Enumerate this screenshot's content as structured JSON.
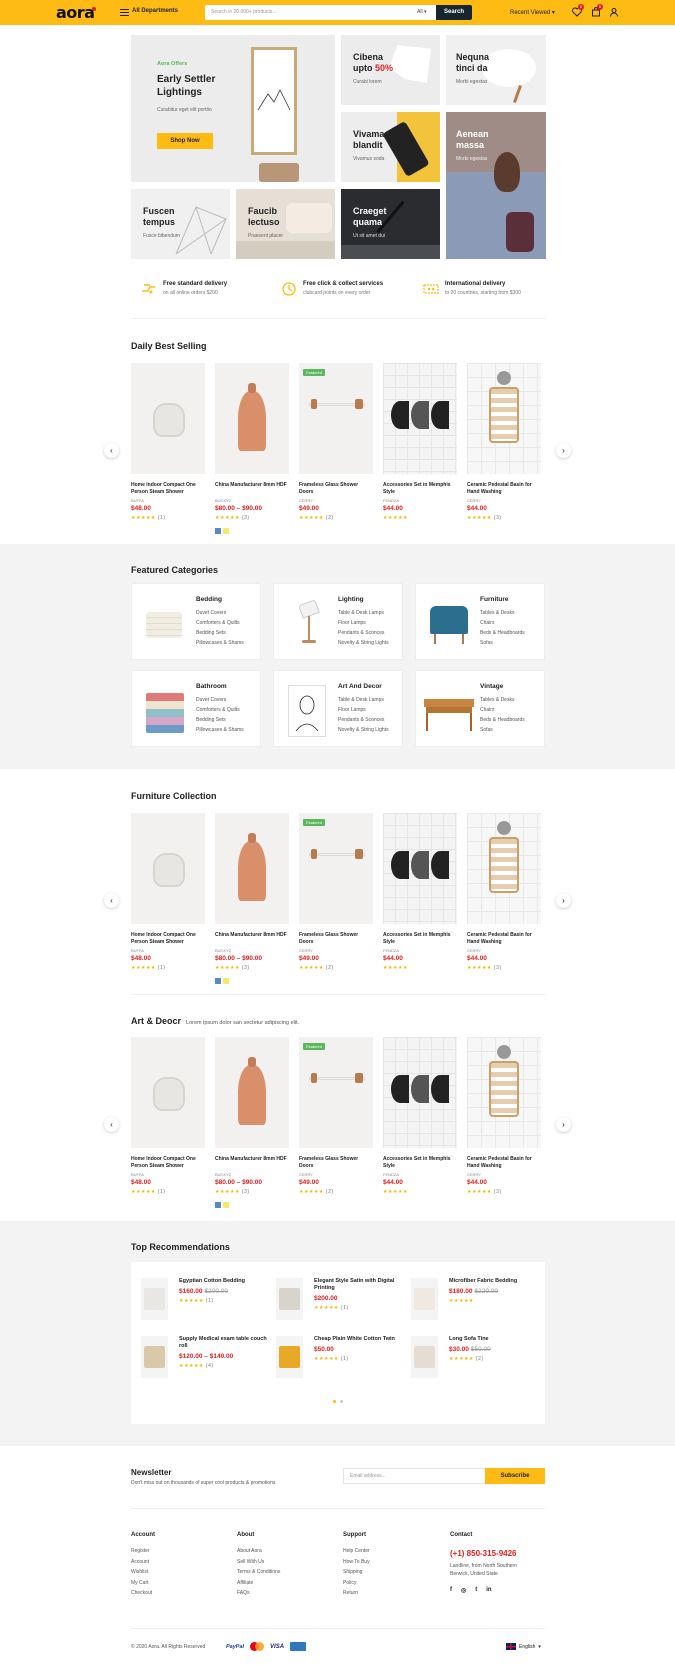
{
  "header": {
    "logo": "aora",
    "all_departments": "All Departments",
    "search_placeholder": "Search in 20.000+ products...",
    "search_category": "All",
    "search_button": "Search",
    "recent_viewed": "Recent Viewed",
    "wishlist_count": "0",
    "cart_count": "0"
  },
  "banners": {
    "main": {
      "tag": "Aora Offers",
      "title_1": "Early Settler",
      "title_2": "Lightings",
      "sub": "Curabitur eget elit porttio",
      "button": "Shop Now"
    },
    "b1": {
      "title_1": "Cibena",
      "title_2": "upto",
      "discount": "50%",
      "sub": "Curabi lorem"
    },
    "b2": {
      "title_1": "Nequna",
      "title_2": "tinci da",
      "sub": "Morbi egestas"
    },
    "b3": {
      "title_1": "Vivama",
      "title_2": "blandit",
      "sub": "Vivamus soda"
    },
    "b4": {
      "title_1": "Aenean",
      "title_2": "massa",
      "sub": "Morbi egestas"
    },
    "b5": {
      "title_1": "Fuscen",
      "title_2": "tempus",
      "sub": "Fusce bibendum"
    },
    "b6": {
      "title_1": "Faucib",
      "title_2": "lectuso",
      "sub": "Praesent placer"
    },
    "b7": {
      "title_1": "Craeget",
      "title_2": "quama",
      "sub": "Ut sit amet dui"
    }
  },
  "features": [
    {
      "title": "Free standard delivery",
      "sub": "on all online orders $200"
    },
    {
      "title": "Free click & collect services",
      "sub": "clubcard points on every order"
    },
    {
      "title": "International delivery",
      "sub": "to 20 countries, starting from $300"
    }
  ],
  "sections": {
    "daily": "Daily Best Selling",
    "categories": "Featured Categories",
    "furniture": "Furniture Collection",
    "art": "Art & Deocr",
    "art_sub": "Lorem ipsum dolor san sectetur adipiscing elit.",
    "recommend": "Top Recommendations"
  },
  "products": [
    {
      "name": "Home Indoor Compact One Person Steam Shower",
      "brand": "BUFFA",
      "price": "$48.00",
      "rating": "(1)",
      "featured": ""
    },
    {
      "name": "China Manufacturer 8mm HDF",
      "brand": "BUCKYZ",
      "price": "$80.00 – $90.00",
      "rating": "(3)",
      "featured": ""
    },
    {
      "name": "Frameless Glass Shower Doors",
      "brand": "CERRY",
      "price": "$49.00",
      "rating": "(2)",
      "featured": "Featured"
    },
    {
      "name": "Accessories Set in Memphis Style",
      "brand": "FENDZA",
      "price": "$44.00",
      "rating": "",
      "featured": ""
    },
    {
      "name": "Ceramic Pedestal Basin for Hand Washing",
      "brand": "CERRY",
      "price": "$44.00",
      "rating": "(3)",
      "featured": ""
    }
  ],
  "categories": [
    {
      "name": "Bedding",
      "items": [
        "Duvet Covers",
        "Comforters & Quilts",
        "Bedding Sets",
        "Pillowcases & Shams"
      ]
    },
    {
      "name": "Lighting",
      "items": [
        "Table & Desk Lamps",
        "Floor Lamps",
        "Pendants & Sconces",
        "Novelty & String Lights"
      ]
    },
    {
      "name": "Furniture",
      "items": [
        "Tables & Desks",
        "Chairs",
        "Beds & Headboards",
        "Sofas"
      ]
    },
    {
      "name": "Bathroom",
      "items": [
        "Duvet Covers",
        "Comforters & Quilts",
        "Bedding Sets",
        "Pillowcases & Shams"
      ]
    },
    {
      "name": "Art And Decor",
      "items": [
        "Table & Desk Lamps",
        "Floor Lamps",
        "Pendants & Sconces",
        "Novelty & String Lights"
      ]
    },
    {
      "name": "Vintage",
      "items": [
        "Tables & Desks",
        "Chairs",
        "Beds & Headboards",
        "Sofas"
      ]
    }
  ],
  "recommendations": [
    {
      "name": "Egyptian Cotton Bedding",
      "price": "$160.00",
      "old": "$200.00",
      "rating": "(1)"
    },
    {
      "name": "Elegant Style Satin with Digital Printing",
      "price": "$200.00",
      "old": "",
      "rating": "(1)"
    },
    {
      "name": "Microfiber Fabric Bedding",
      "price": "$180.00",
      "old": "$220.00",
      "rating": ""
    },
    {
      "name": "Supply Medical exam table couch roll",
      "price": "$120.00 – $140.00",
      "old": "",
      "rating": "(4)"
    },
    {
      "name": "Cheap Plain White Cotton Twin",
      "price": "$50.00",
      "old": "",
      "rating": "(1)"
    },
    {
      "name": "Long Sofa Tine",
      "price": "$30.00",
      "old": "$50.00",
      "rating": "(2)"
    }
  ],
  "newsletter": {
    "title": "Newsletter",
    "sub": "Don't miss out on thousands of super cool products & promotions",
    "placeholder": "Email address...",
    "button": "Subscribe"
  },
  "footer": {
    "account": {
      "title": "Account",
      "links": [
        "Register",
        "Account",
        "Wishlist",
        "My Cart",
        "Checkout"
      ]
    },
    "about": {
      "title": "About",
      "links": [
        "About Aora",
        "Sell With Us",
        "Terms & Conditions",
        "Affiliate",
        "FAQs"
      ]
    },
    "support": {
      "title": "Support",
      "links": [
        "Help Center",
        "How To Buy",
        "Shipping",
        "Policy",
        "Return"
      ]
    },
    "contact": {
      "title": "Contact",
      "phone": "(+1) 850-315-9426",
      "address_1": "Landline, from North Southern",
      "address_2": "Berwick, United State"
    },
    "copyright": "© 2020 Aora. All Rights Reserved",
    "payments": [
      "PayPal",
      "VISA"
    ],
    "language": "English"
  },
  "colors": {
    "accent": "#fdbb13",
    "price": "#e02020",
    "dark": "#16262f",
    "featured": "#5cb85c"
  }
}
